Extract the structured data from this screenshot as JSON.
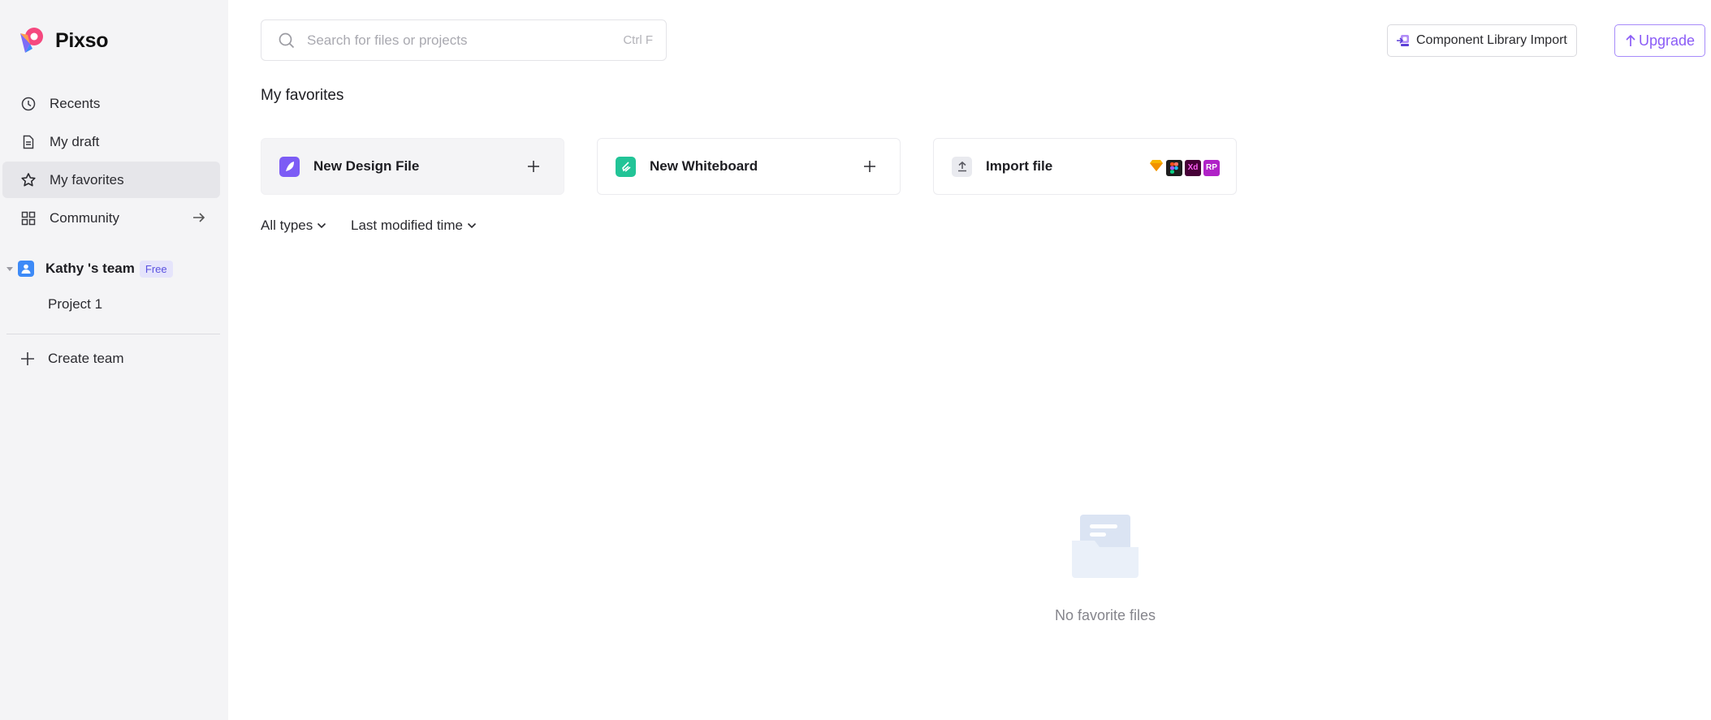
{
  "app": {
    "name": "Pixso",
    "accent": "#8b5cf6"
  },
  "sidebar": {
    "items": [
      {
        "label": "Recents",
        "icon": "clock-icon"
      },
      {
        "label": "My draft",
        "icon": "file-icon"
      },
      {
        "label": "My favorites",
        "icon": "star-icon",
        "active": true
      },
      {
        "label": "Community",
        "icon": "grid-icon"
      }
    ],
    "team": {
      "name": "Kathy 's team",
      "plan": "Free"
    },
    "projects": [
      {
        "label": "Project 1"
      }
    ],
    "create_team_label": "Create team"
  },
  "header": {
    "search": {
      "placeholder": "Search for files or projects",
      "shortcut": "Ctrl F"
    },
    "component_import_label": "Component Library Import",
    "upgrade_label": "Upgrade"
  },
  "main": {
    "title": "My favorites",
    "cards": [
      {
        "label": "New Design File",
        "icon": "design-file-icon",
        "color": "#7c5cf5"
      },
      {
        "label": "New Whiteboard",
        "icon": "whiteboard-icon",
        "color": "#22c497"
      },
      {
        "label": "Import file",
        "icon": "upload-icon",
        "formats": [
          "Sketch",
          "Figma",
          "Xd",
          "RP"
        ]
      }
    ],
    "filters": {
      "type": "All types",
      "sort": "Last modified time"
    },
    "empty_text": "No favorite files"
  }
}
